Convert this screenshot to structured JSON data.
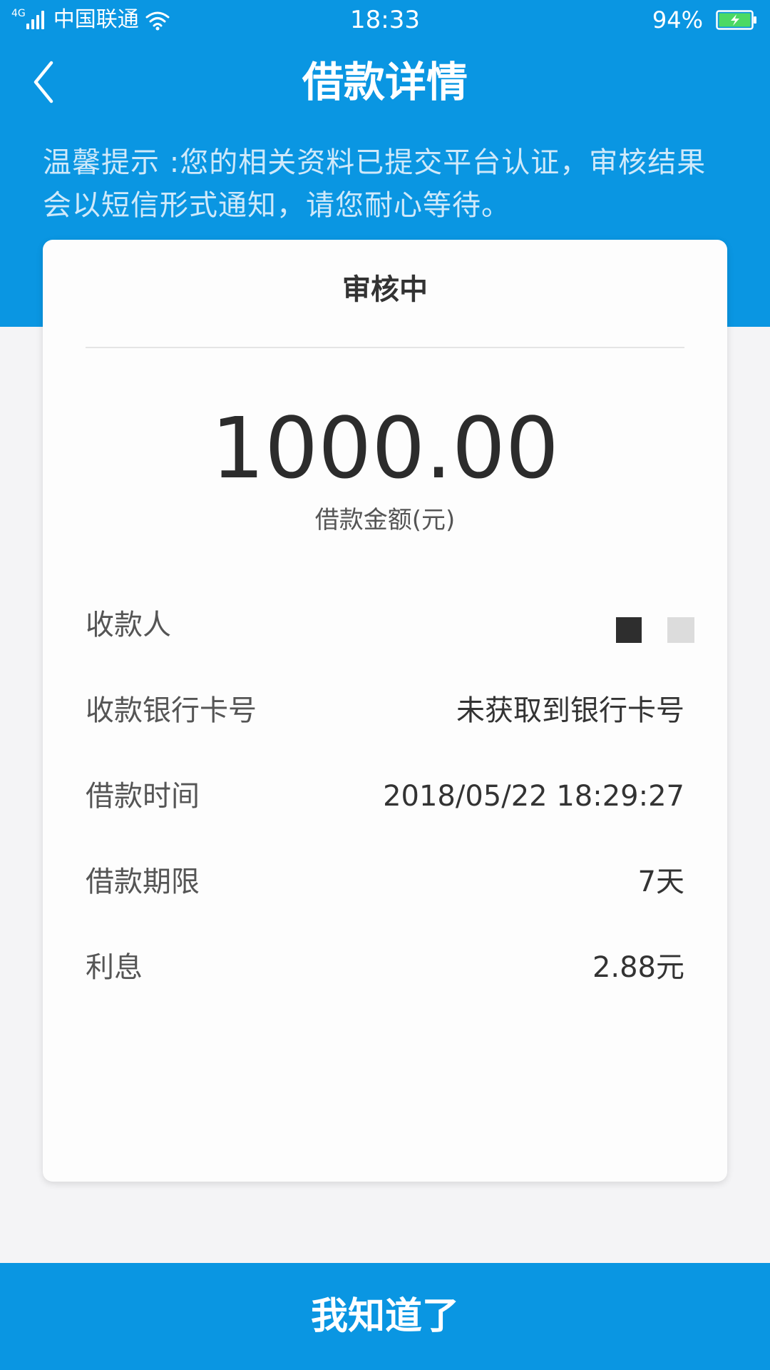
{
  "status_bar": {
    "network_type": "4G",
    "carrier": "中国联通",
    "time": "18:33",
    "battery_percent": "94%"
  },
  "header": {
    "title": "借款详情"
  },
  "notice": {
    "text": "温馨提示 :您的相关资料已提交平台认证，审核结果会以短信形式通知，请您耐心等待。"
  },
  "card": {
    "status": "审核中",
    "amount": "1000.00",
    "amount_label": "借款金额(元)",
    "rows": [
      {
        "label": "收款人",
        "value": ""
      },
      {
        "label": "收款银行卡号",
        "value": "未获取到银行卡号"
      },
      {
        "label": "借款时间",
        "value": "2018/05/22 18:29:27"
      },
      {
        "label": "借款期限",
        "value": "7天"
      },
      {
        "label": "利息",
        "value": "2.88元"
      }
    ]
  },
  "footer": {
    "confirm_label": "我知道了"
  },
  "colors": {
    "primary": "#0a96e2",
    "card_bg": "#fdfdfd",
    "page_bg": "#f4f4f6",
    "text_dark": "#333333",
    "text_muted": "#555555"
  }
}
